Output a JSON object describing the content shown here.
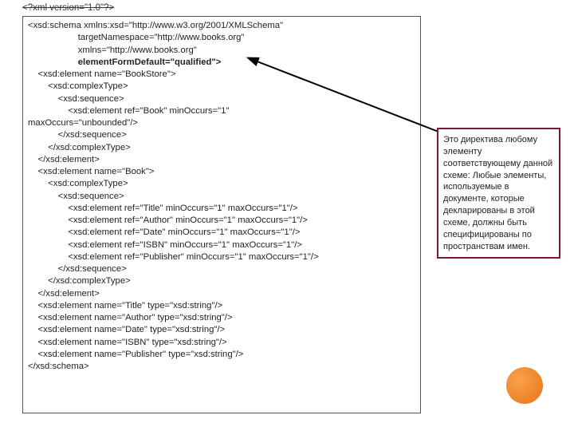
{
  "xmlDecl": "<?xml version=\"1.0\"?>",
  "code": {
    "l0": "<xsd:schema xmlns:xsd=\"http://www.w3.org/2001/XMLSchema\"",
    "l1": "                    targetNamespace=\"http://www.books.org\"",
    "l2": "                    xmlns=\"http://www.books.org\"",
    "l3": "                    elementFormDefault=\"qualified\">",
    "l4": "    <xsd:element name=\"BookStore\">",
    "l5": "        <xsd:complexType>",
    "l6": "            <xsd:sequence>",
    "l7": "                <xsd:element ref=\"Book\" minOccurs=\"1\"",
    "l8": "maxOccurs=\"unbounded\"/>",
    "l9": "            </xsd:sequence>",
    "l10": "        </xsd:complexType>",
    "l11": "    </xsd:element>",
    "l12": "    <xsd:element name=\"Book\">",
    "l13": "        <xsd:complexType>",
    "l14": "            <xsd:sequence>",
    "l15": "                <xsd:element ref=\"Title\" minOccurs=\"1\" maxOccurs=\"1\"/>",
    "l16": "                <xsd:element ref=\"Author\" minOccurs=\"1\" maxOccurs=\"1\"/>",
    "l17": "                <xsd:element ref=\"Date\" minOccurs=\"1\" maxOccurs=\"1\"/>",
    "l18": "                <xsd:element ref=\"ISBN\" minOccurs=\"1\" maxOccurs=\"1\"/>",
    "l19": "                <xsd:element ref=\"Publisher\" minOccurs=\"1\" maxOccurs=\"1\"/>",
    "l20": "            </xsd:sequence>",
    "l21": "        </xsd:complexType>",
    "l22": "    </xsd:element>",
    "l23": "    <xsd:element name=\"Title\" type=\"xsd:string\"/>",
    "l24": "    <xsd:element name=\"Author\" type=\"xsd:string\"/>",
    "l25": "    <xsd:element name=\"Date\" type=\"xsd:string\"/>",
    "l26": "    <xsd:element name=\"ISBN\" type=\"xsd:string\"/>",
    "l27": "    <xsd:element name=\"Publisher\" type=\"xsd:string\"/>",
    "l28": "</xsd:schema>"
  },
  "annotation": "Это директива любому элементу соответствующему данной схеме:\nЛюбые элементы, используемые в документе, которые декларированы в этой схеме, должны быть специфицированы по пространствам имен."
}
